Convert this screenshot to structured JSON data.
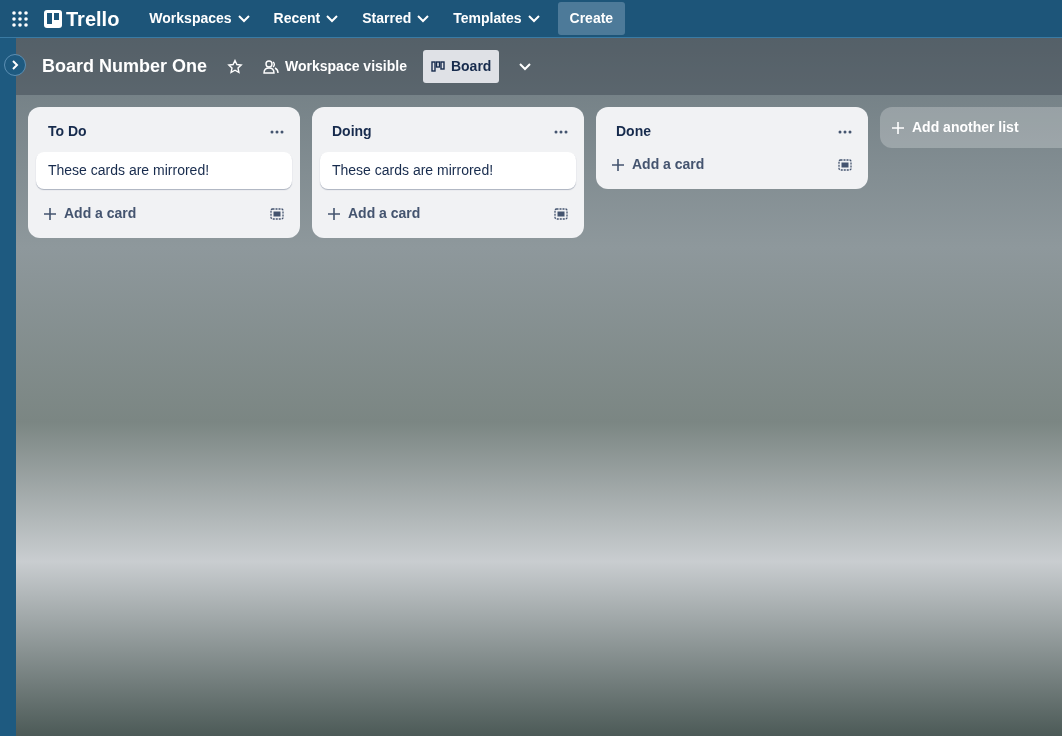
{
  "topbar": {
    "logo": "Trello",
    "menus": [
      {
        "label": "Workspaces"
      },
      {
        "label": "Recent"
      },
      {
        "label": "Starred"
      },
      {
        "label": "Templates"
      }
    ],
    "create_button": "Create"
  },
  "board_header": {
    "title": "Board Number One",
    "visibility": "Workspace visible",
    "view": {
      "label": "Board",
      "selected": true
    }
  },
  "lists": [
    {
      "title": "To Do",
      "cards": [
        "These cards are mirrored!"
      ],
      "add_label": "Add a card"
    },
    {
      "title": "Doing",
      "cards": [
        "These cards are mirrored!"
      ],
      "add_label": "Add a card"
    },
    {
      "title": "Done",
      "add_label": "Add a card"
    }
  ],
  "add_list": "Add another list"
}
